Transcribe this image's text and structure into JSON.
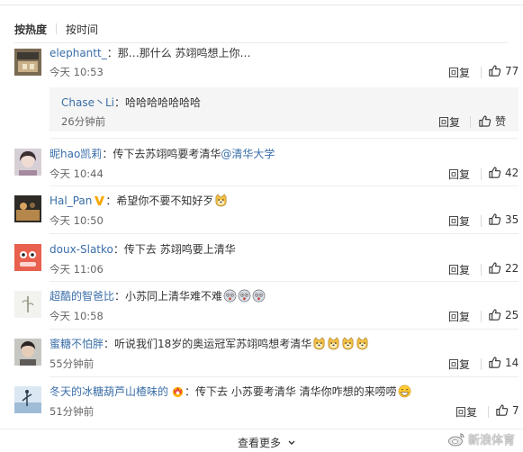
{
  "sort": {
    "hot": "按热度",
    "time": "按时间"
  },
  "labels": {
    "reply": "回复",
    "praise": "赞"
  },
  "comments": [
    {
      "user": "elephantt_",
      "sep": "：",
      "text": "那…那什么 苏翊鸣想上你…",
      "time": "今天 10:53",
      "likes": "77"
    },
    {
      "user": "昵hao凯莉",
      "sep": "：",
      "text": "传下去苏翊鸣要考清华",
      "mention": "@清华大学",
      "time": "今天 10:44",
      "likes": "42"
    },
    {
      "user": "Hal_Pan",
      "sep": "：",
      "text": "希望你不要不知好歹",
      "time": "今天 10:50",
      "likes": "35"
    },
    {
      "user": "doux-Slatko",
      "sep": "：",
      "text": "传下去 苏翊鸣要上清华",
      "time": "今天 11:06",
      "likes": "22"
    },
    {
      "user": "超酷的智爸比",
      "sep": "：",
      "text": "小苏同上清华难不难",
      "time": "今天 10:58",
      "likes": "25"
    },
    {
      "user": "蜜糖不怕胖",
      "sep": "：",
      "text": "听说我们18岁的奥运冠军苏翊鸣想考清华",
      "time": "55分钟前",
      "likes": "14"
    },
    {
      "user": "冬天的冰糖葫芦山楂味的",
      "sep": "：",
      "text": "传下去 小苏要考清华 清华你咋想的来唠唠",
      "time": "51分钟前",
      "likes": "7"
    }
  ],
  "subreply": {
    "user": "Chase丶Li",
    "sep": "：",
    "text": "哈哈哈哈哈哈哈",
    "time": "26分钟前"
  },
  "more": "查看更多",
  "watermark": "新浪体育",
  "colors": {
    "username": "#3a6ea8",
    "verified": "#f6a800"
  },
  "icons": {
    "like": "thumbs-up-icon",
    "more": "chevron-down-icon",
    "verified": "verified-v-icon",
    "emoji": "doge-emoji"
  }
}
